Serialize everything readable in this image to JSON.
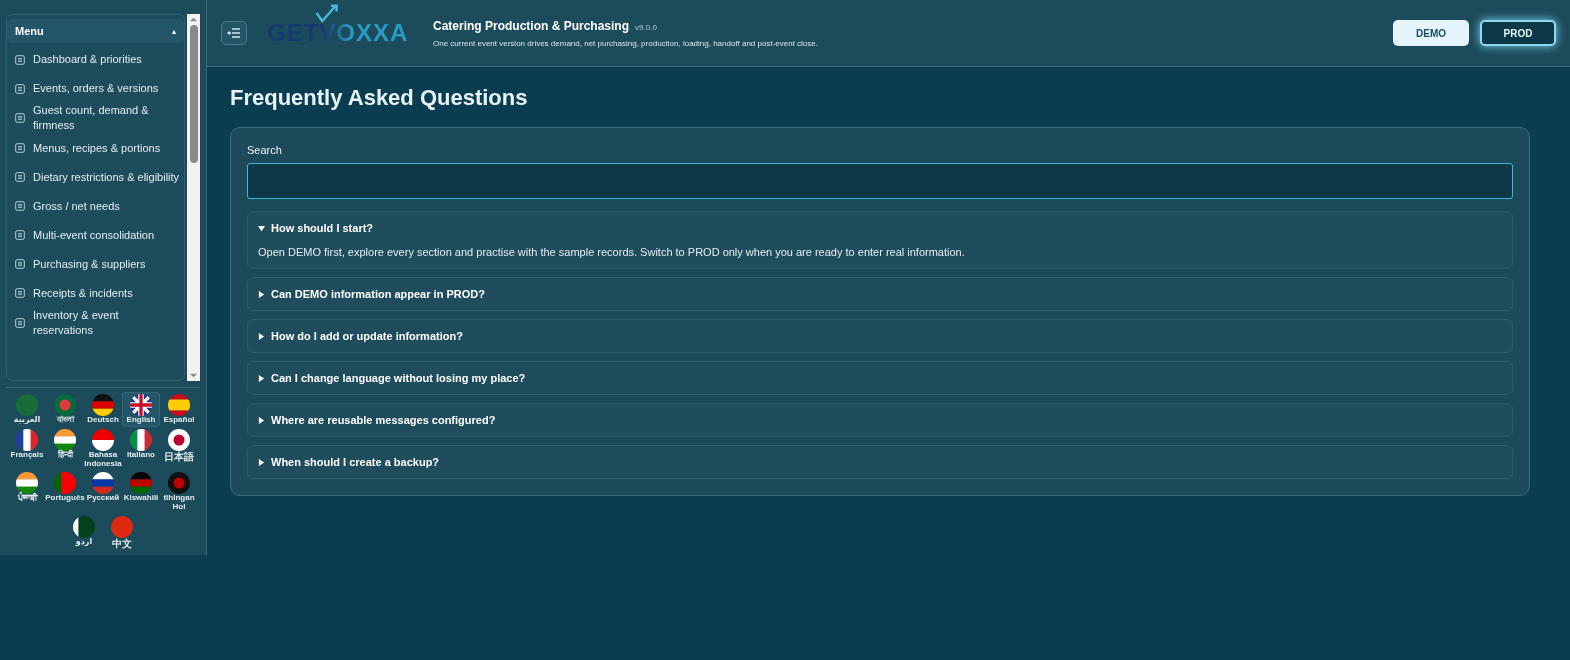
{
  "sidebar": {
    "menu_title": "Menu",
    "collapse_symbol": "▴",
    "items": [
      {
        "label": "Dashboard & priorities"
      },
      {
        "label": "Events, orders & versions"
      },
      {
        "label": "Guest count, demand & firmness"
      },
      {
        "label": "Menus, recipes & portions"
      },
      {
        "label": "Dietary restrictions & eligibility"
      },
      {
        "label": "Gross / net needs"
      },
      {
        "label": "Multi-event consolidation"
      },
      {
        "label": "Purchasing & suppliers"
      },
      {
        "label": "Receipts & incidents"
      },
      {
        "label": "Inventory & event reservations"
      }
    ],
    "languages": [
      {
        "label": "العربية",
        "selected": false
      },
      {
        "label": "বাংলা",
        "selected": false
      },
      {
        "label": "Deutsch",
        "selected": false
      },
      {
        "label": "English",
        "selected": true
      },
      {
        "label": "Español",
        "selected": false
      },
      {
        "label": "Français",
        "selected": false
      },
      {
        "label": "हिन्दी",
        "selected": false
      },
      {
        "label": "Bahasa Indonesia",
        "selected": false
      },
      {
        "label": "Italiano",
        "selected": false
      },
      {
        "label": "日本語",
        "selected": false
      },
      {
        "label": "ਪੰਜਾਬੀ",
        "selected": false
      },
      {
        "label": "Português",
        "selected": false
      },
      {
        "label": "Русский",
        "selected": false
      },
      {
        "label": "Kiswahili",
        "selected": false
      },
      {
        "label": "tlhIngan Hol",
        "selected": false
      },
      {
        "label": "اردو",
        "selected": false
      },
      {
        "label": "中文",
        "selected": false
      }
    ]
  },
  "header": {
    "logo": "GETVOXXA",
    "title": "Catering Production & Purchasing",
    "version": "v9.0.0",
    "subtitle": "One current event version drives demand, net purchasing, production, loading, handoff and post-event close.",
    "modes": [
      {
        "label": "DEMO",
        "selected": false
      },
      {
        "label": "PROD",
        "selected": true
      }
    ]
  },
  "page": {
    "title": "Frequently Asked Questions",
    "search": {
      "label": "Search"
    },
    "faqs": [
      {
        "question": "How should I start?",
        "expanded": true,
        "answer": "Open DEMO first, explore every section and practise with the sample records. Switch to PROD only when you are ready to enter real information."
      },
      {
        "question": "Can DEMO information appear in PROD?",
        "expanded": false
      },
      {
        "question": "How do I add or update information?",
        "expanded": false
      },
      {
        "question": "Can I change language without losing my place?",
        "expanded": false
      },
      {
        "question": "Where are reusable messages configured?",
        "expanded": false
      },
      {
        "question": "When should I create a backup?",
        "expanded": false
      }
    ]
  }
}
